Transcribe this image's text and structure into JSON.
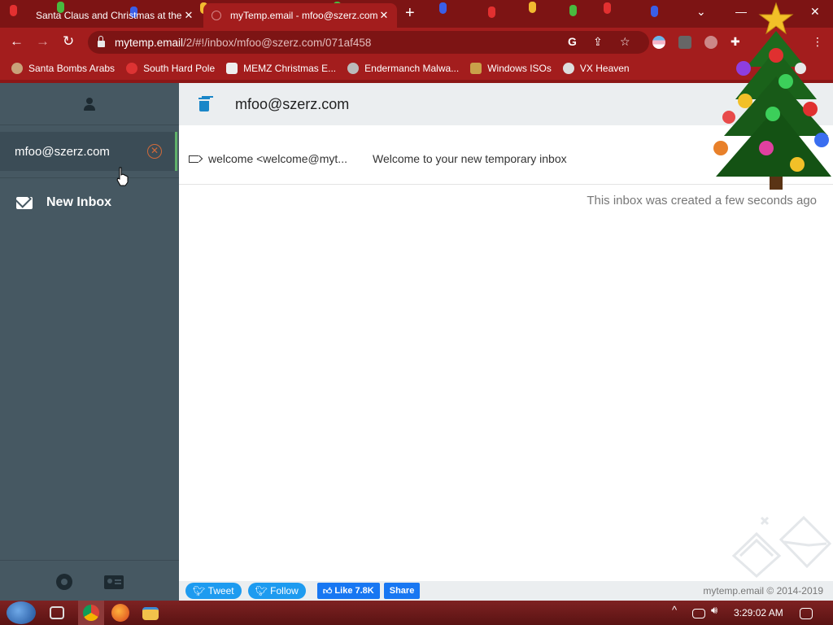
{
  "browser": {
    "tabs": [
      {
        "title": "Santa Claus and Christmas at the",
        "active": false
      },
      {
        "title": "myTemp.email - mfoo@szerz.com",
        "active": true
      }
    ],
    "address": {
      "host": "mytemp.email",
      "path": "/2/#!/inbox/mfoo@szerz.com/071af458"
    },
    "bookmarks": [
      {
        "label": "Santa Bombs Arabs",
        "icon": "santa-icon"
      },
      {
        "label": "South Hard Pole",
        "icon": "snowflake-icon"
      },
      {
        "label": "MEMZ Christmas E...",
        "icon": "memz-icon"
      },
      {
        "label": "Endermanch Malwa...",
        "icon": "ender-icon"
      },
      {
        "label": "Windows ISOs",
        "icon": "windows-iso-icon"
      },
      {
        "label": "VX Heaven",
        "icon": "vx-heaven-icon"
      }
    ],
    "theme_color": "#a31d1d"
  },
  "sidebar": {
    "active_inbox": "mfoo@szerz.com",
    "new_inbox_label": "New Inbox",
    "accent_color": "#5fb16a"
  },
  "main": {
    "title": "mfoo@szerz.com",
    "messages": [
      {
        "from": "welcome <welcome@myt...",
        "subject": "Welcome to your new temporary inbox"
      }
    ],
    "created_note": "This inbox was created a few seconds ago"
  },
  "footer": {
    "tweet_label": "Tweet",
    "follow_label": "Follow",
    "like_label": "Like 7.8K",
    "share_label": "Share",
    "copyright": "mytemp.email © 2014-2019"
  },
  "taskbar": {
    "clock": "3:29:02 AM"
  }
}
